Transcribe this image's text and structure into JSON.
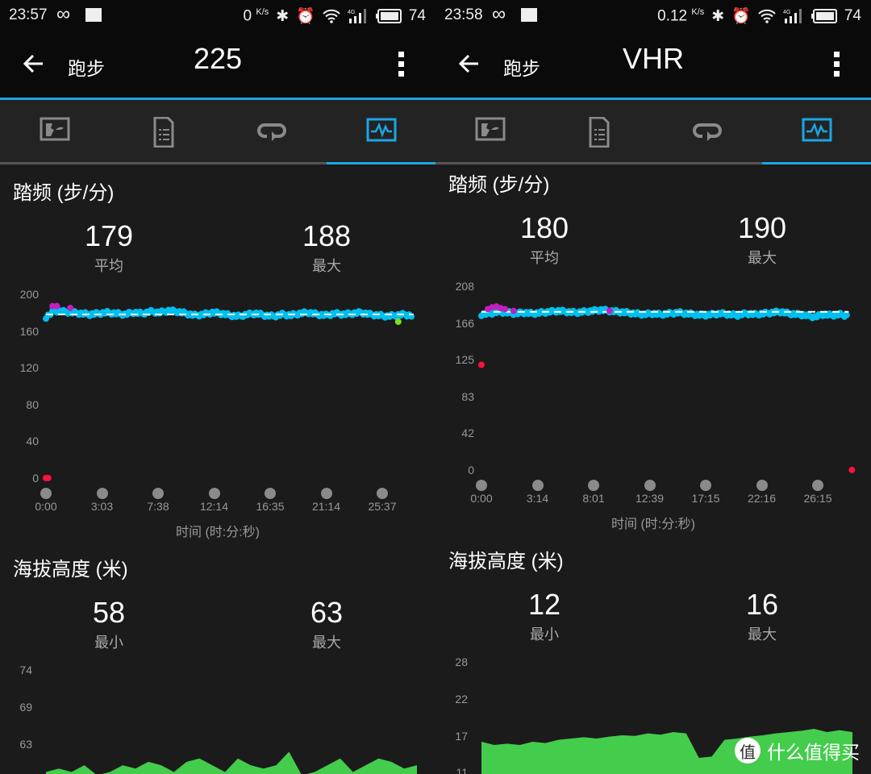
{
  "colors": {
    "accent": "#1ba6e4",
    "cadence_point": "#00bfef",
    "cadence_high": "#c020c0",
    "cadence_low": "#ff1040",
    "cadence_green": "#80e020",
    "altitude_fill": "#44cc4c",
    "average_line": "#ffffff"
  },
  "panels": [
    {
      "status": {
        "time": "23:57",
        "speed": "0",
        "speed_unit": "K/s",
        "battery": "74"
      },
      "appbar": {
        "back_label": "跑步",
        "title": "225"
      },
      "tabs": [
        {
          "icon": "map-icon"
        },
        {
          "icon": "details-list-icon"
        },
        {
          "icon": "laps-icon"
        },
        {
          "icon": "charts-icon",
          "active": true
        }
      ],
      "cadence": {
        "title": "踏频 (步/分)",
        "avg_value": "179",
        "avg_label": "平均",
        "max_value": "188",
        "max_label": "最大"
      },
      "altitude": {
        "title": "海拔高度 (米)",
        "min_value": "58",
        "min_label": "最小",
        "max_value": "63",
        "max_label": "最大"
      }
    },
    {
      "status": {
        "time": "23:58",
        "speed": "0.12",
        "speed_unit": "K/s",
        "battery": "74"
      },
      "appbar": {
        "back_label": "跑步",
        "title": "VHR"
      },
      "tabs": [
        {
          "icon": "map-icon"
        },
        {
          "icon": "details-list-icon"
        },
        {
          "icon": "laps-icon"
        },
        {
          "icon": "charts-icon",
          "active": true
        }
      ],
      "cadence": {
        "title": "踏频 (步/分)",
        "avg_value": "180",
        "avg_label": "平均",
        "max_value": "190",
        "max_label": "最大"
      },
      "altitude": {
        "title": "海拔高度 (米)",
        "min_value": "12",
        "min_label": "最小",
        "max_value": "16",
        "max_label": "最大"
      }
    }
  ],
  "chart_data": [
    {
      "type": "scatter",
      "panel": 0,
      "xlabel": "时间 (时:分:秒)",
      "ylabel": "",
      "yticks": [
        "200",
        "160",
        "120",
        "80",
        "40",
        "0"
      ],
      "ylim": [
        0,
        200
      ],
      "xticks": [
        "0:00",
        "3:03",
        "7:38",
        "12:14",
        "16:35",
        "21:14",
        "25:37"
      ],
      "xtick_seconds": [
        0,
        183,
        458,
        734,
        995,
        1274,
        1537
      ],
      "average": 179,
      "x_step_seconds": 40,
      "values": [
        176,
        183,
        182,
        181,
        180,
        179,
        180,
        181,
        180,
        179,
        181,
        180,
        182,
        181,
        183,
        182,
        180,
        178,
        179,
        181,
        180,
        178,
        177,
        179,
        180,
        178,
        177,
        179,
        178,
        180,
        181,
        179,
        178,
        180,
        179,
        180,
        181,
        179,
        178,
        177,
        178,
        179,
        177
      ],
      "highlights": [
        {
          "x": 30,
          "y": 188,
          "color": "cadence_high"
        },
        {
          "x": 50,
          "y": 188,
          "color": "cadence_high"
        },
        {
          "x": 111,
          "y": 186,
          "color": "cadence_high"
        },
        {
          "x": 0,
          "y": 1,
          "color": "cadence_low"
        },
        {
          "x": 10,
          "y": 1,
          "color": "cadence_low"
        },
        {
          "x": 1610,
          "y": 171,
          "color": "cadence_green"
        }
      ]
    },
    {
      "type": "area",
      "panel": 0,
      "yticks": [
        "74",
        "69",
        "63"
      ],
      "ylim_visible": [
        63,
        74
      ],
      "values": [
        59,
        59.5,
        59,
        60,
        58.5,
        59,
        60,
        59.5,
        60.5,
        60,
        59,
        60.5,
        61,
        60,
        59,
        61,
        60,
        59.5,
        60,
        62,
        58.5,
        59,
        60,
        61,
        59,
        60,
        61,
        60.5,
        59.5,
        60
      ]
    },
    {
      "type": "scatter",
      "panel": 1,
      "xlabel": "时间 (时:分:秒)",
      "ylabel": "",
      "yticks": [
        "208",
        "166",
        "125",
        "83",
        "42",
        "0"
      ],
      "ylim": [
        0,
        208
      ],
      "xticks": [
        "0:00",
        "3:14",
        "8:01",
        "12:39",
        "17:15",
        "22:16",
        "26:15"
      ],
      "xtick_seconds": [
        0,
        194,
        481,
        759,
        1035,
        1336,
        1575
      ],
      "average": 180,
      "x_step_seconds": 40,
      "values": [
        177,
        178,
        180,
        179,
        178,
        179,
        178,
        179,
        180,
        181,
        180,
        179,
        180,
        181,
        182,
        181,
        180,
        179,
        178,
        177,
        178,
        177,
        178,
        179,
        178,
        177,
        176,
        177,
        178,
        177,
        176,
        178,
        177,
        178,
        179,
        180,
        178,
        177,
        176,
        174,
        177,
        176,
        177,
        175
      ],
      "highlights": [
        {
          "x": 30,
          "y": 183,
          "color": "cadence_high"
        },
        {
          "x": 50,
          "y": 185,
          "color": "cadence_high"
        },
        {
          "x": 70,
          "y": 186,
          "color": "cadence_high"
        },
        {
          "x": 90,
          "y": 184,
          "color": "cadence_high"
        },
        {
          "x": 110,
          "y": 183,
          "color": "cadence_high"
        },
        {
          "x": 150,
          "y": 181,
          "color": "cadence_high"
        },
        {
          "x": 600,
          "y": 181,
          "color": "cadence_high"
        },
        {
          "x": 0,
          "y": 120,
          "color": "cadence_low"
        },
        {
          "x": 1735,
          "y": 1,
          "color": "cadence_low"
        }
      ]
    },
    {
      "type": "area",
      "panel": 1,
      "yticks": [
        "28",
        "22",
        "17",
        "11"
      ],
      "ylim_visible": [
        11,
        28
      ],
      "values": [
        14.5,
        14,
        14.2,
        14,
        14.5,
        14.3,
        14.8,
        15,
        15.2,
        15,
        15.3,
        15.5,
        15.4,
        15.8,
        15.6,
        16,
        15.8,
        12,
        12.2,
        14.8,
        15,
        15.3,
        15.5,
        15.8,
        16,
        16.2,
        16.5,
        16,
        16.3,
        16
      ]
    }
  ],
  "watermark": {
    "logo": "值",
    "text": "什么值得买"
  }
}
